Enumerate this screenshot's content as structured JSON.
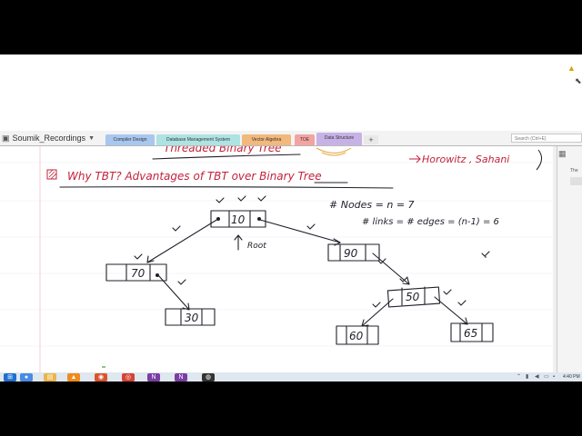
{
  "notebook": {
    "name": "Soumik_Recordings"
  },
  "sections": [
    {
      "label": "Compiler Design",
      "color": "#a7c7ef"
    },
    {
      "label": "Database Management System",
      "color": "#aee3e3"
    },
    {
      "label": "Vector Algebra",
      "color": "#f2b87c"
    },
    {
      "label": "TOE",
      "color": "#f4a3a3"
    },
    {
      "label": "Data Structure",
      "color": "#c7b2e6"
    }
  ],
  "add_section_label": "+",
  "search": {
    "placeholder": "Search (Ctrl+E)"
  },
  "side_panel": {
    "page_label": "The"
  },
  "note": {
    "top_partial": "Threaded Binary Tree",
    "book_ref": "Horowitz , Sahani",
    "heading": "Why TBT?  Advantages of TBT over Binary Tree",
    "nodes_note": "# Nodes = n = 7",
    "links_note": "# links = # edges = (n-1) = 6",
    "root_label": "Root"
  },
  "tree": {
    "nodes": [
      {
        "id": "n10",
        "value": "10"
      },
      {
        "id": "n70",
        "value": "70"
      },
      {
        "id": "n90",
        "value": "90"
      },
      {
        "id": "n30",
        "value": "30"
      },
      {
        "id": "n50",
        "value": "50"
      },
      {
        "id": "n60",
        "value": "60"
      },
      {
        "id": "n65",
        "value": "65"
      }
    ]
  },
  "taskbar": {
    "clock": "4:40 PM",
    "apps": [
      {
        "name": "chrome-icon",
        "color": "#4a8be3",
        "glyph": "●"
      },
      {
        "name": "file-explorer-icon",
        "color": "#e8b54a",
        "glyph": "▤"
      },
      {
        "name": "vlc-icon",
        "color": "#ee8a1f",
        "glyph": "▲"
      },
      {
        "name": "firefox-icon",
        "color": "#d9542d",
        "glyph": "◉"
      },
      {
        "name": "chrome-icon",
        "color": "#d44336",
        "glyph": "◎"
      },
      {
        "name": "onenote-icon",
        "color": "#7b3fa3",
        "glyph": "N"
      },
      {
        "name": "onenote-icon",
        "color": "#7b3fa3",
        "glyph": "N"
      },
      {
        "name": "obs-icon",
        "color": "#333333",
        "glyph": "◍"
      }
    ]
  }
}
